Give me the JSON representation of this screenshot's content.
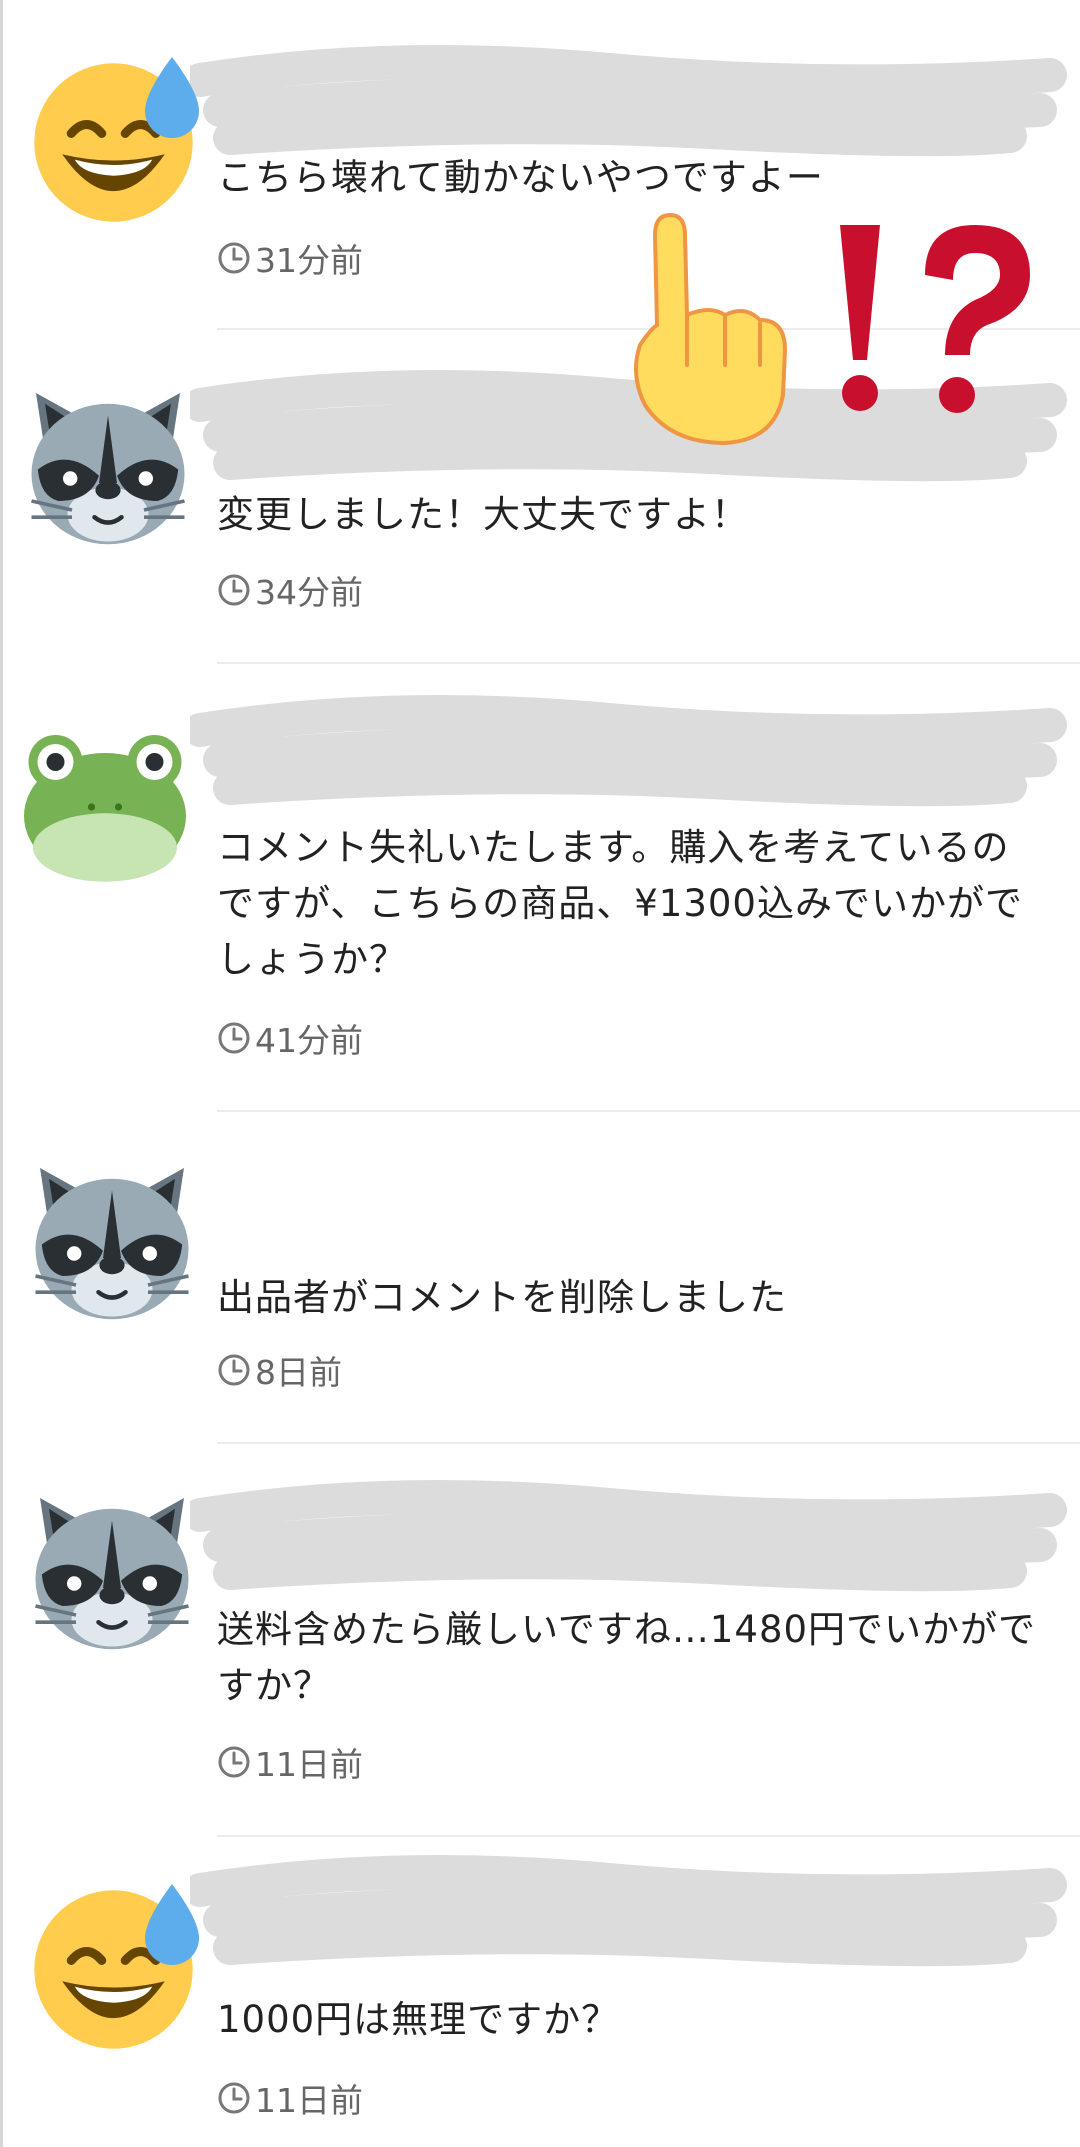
{
  "comments": [
    {
      "avatar": "grinning-sweat-face-icon",
      "text": "こちら壊れて動かないやつですよー",
      "time": "31分前"
    },
    {
      "avatar": "raccoon-icon",
      "text": "変更しました！大丈夫ですよ！",
      "time": "34分前"
    },
    {
      "avatar": "frog-icon",
      "text": "コメント失礼いたします。購入を考えているのですが、こちらの商品、¥1300込みでいかがでしょうか？",
      "time": "41分前"
    },
    {
      "avatar": "raccoon-icon",
      "text": "出品者がコメントを削除しました",
      "time": "8日前"
    },
    {
      "avatar": "raccoon-icon",
      "text": "送料含めたら厳しいですね…1480円でいかがですか？",
      "time": "11日前"
    },
    {
      "avatar": "grinning-sweat-face-icon",
      "text": "1000円は無理ですか？",
      "time": "11日前"
    }
  ],
  "overlay": {
    "icons": [
      "index-pointing-up-icon",
      "interrobang-icon"
    ]
  },
  "colors": {
    "divider": "#ececec",
    "time_text": "#666666",
    "scribble": "#dcdcdc",
    "interrobang": "#c8102e"
  }
}
